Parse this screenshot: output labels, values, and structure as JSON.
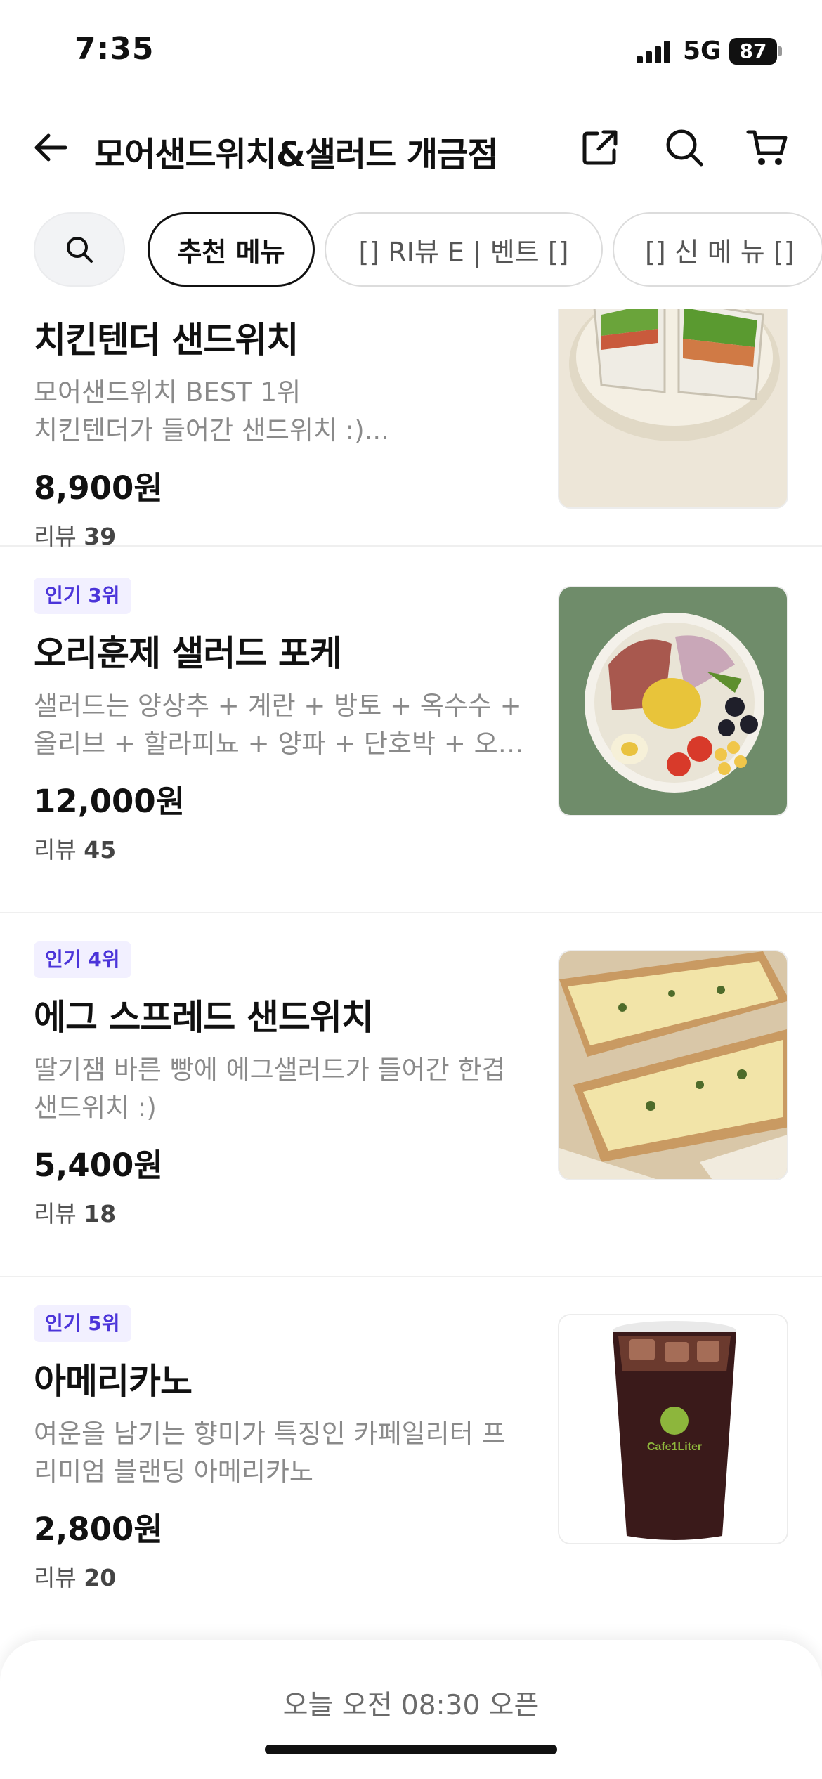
{
  "status": {
    "time": "7:35",
    "network": "5G",
    "battery": "87"
  },
  "header": {
    "title": "모어샌드위치&샐러드 개금점"
  },
  "chips": {
    "active": "추천 메뉴",
    "review_event": "[] RI뷰 E | 벤트 []",
    "new_menu": "[] 신 메 뉴 []"
  },
  "items": [
    {
      "name": "치킨텐더 샌드위치",
      "desc": [
        "모어샌드위치 BEST 1위",
        "치킨텐더가 들어간 샌드위치 :)..."
      ],
      "price": "8,900원",
      "review_label": "리뷰",
      "review_count": "39"
    },
    {
      "badge": "인기 3위",
      "name": "오리훈제 샐러드 포케",
      "desc": [
        "샐러드는 양상추 + 계란 + 방토 + 옥수수 +",
        "올리브 + 할라피뇨 + 양파 + 단호박 + 오리…"
      ],
      "price": "12,000원",
      "review_label": "리뷰",
      "review_count": "45"
    },
    {
      "badge": "인기 4위",
      "name": "에그 스프레드 샌드위치",
      "desc": [
        "딸기잼 바른 빵에 에그샐러드가 들어간 한겹",
        "샌드위치 :)"
      ],
      "price": "5,400원",
      "review_label": "리뷰",
      "review_count": "18"
    },
    {
      "badge": "인기 5위",
      "name": "아메리카노",
      "desc": [
        "여운을 남기는 향미가 특징인 카페일리터 프",
        "리미엄 블랜딩 아메리카노"
      ],
      "price": "2,800원",
      "review_label": "리뷰",
      "review_count": "20"
    }
  ],
  "cup_logo": "Cafe1Liter",
  "bottom": {
    "open_text": "오늘 오전 08:30 오픈"
  },
  "colors": {
    "badge_text": "#4b34d9",
    "badge_bg": "#f2f0ff"
  },
  "icons": [
    "back-arrow-icon",
    "share-icon",
    "search-icon",
    "cart-icon"
  ]
}
